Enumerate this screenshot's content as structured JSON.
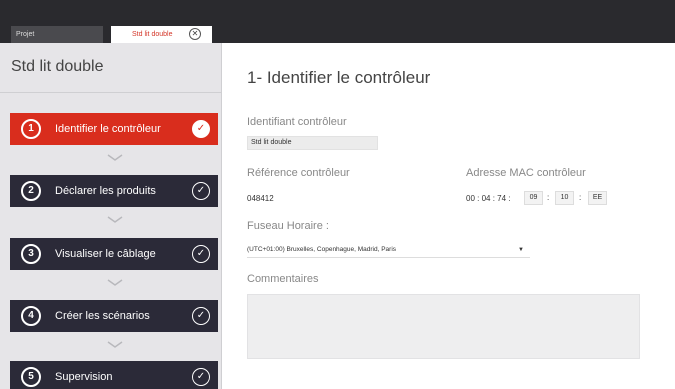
{
  "tabs": {
    "project_label": "Projet",
    "active_label": "Std lit double",
    "close_icon": "close-circle-icon"
  },
  "sidebar": {
    "title": "Std lit double",
    "steps": [
      {
        "number": "1",
        "label": "Identifier le contrôleur",
        "state": "active"
      },
      {
        "number": "2",
        "label": "Déclarer les produits",
        "state": "pending"
      },
      {
        "number": "3",
        "label": "Visualiser le câblage",
        "state": "pending"
      },
      {
        "number": "4",
        "label": "Créer les scénarios",
        "state": "pending"
      },
      {
        "number": "5",
        "label": "Supervision",
        "state": "pending"
      }
    ]
  },
  "main": {
    "title": "1- Identifier le contrôleur",
    "id_label": "Identifiant contrôleur",
    "id_value": "Std lit double",
    "ref_label": "Référence contrôleur",
    "ref_value": "048412",
    "mac_label": "Adresse MAC contrôleur",
    "mac_fixed": "00 : 04 : 74 :",
    "mac_sep": ":",
    "mac_parts": [
      "09",
      "10",
      "EE"
    ],
    "tz_label": "Fuseau Horaire :",
    "tz_value": "(UTC+01:00) Bruxelles, Copenhague, Madrid, Paris",
    "comments_label": "Commentaires",
    "comments_value": ""
  },
  "colors": {
    "accent": "#d92d1d",
    "step_bg": "#2b2a38",
    "topbar": "#2a2a2e",
    "sidebar_bg": "#e6e5e8"
  }
}
